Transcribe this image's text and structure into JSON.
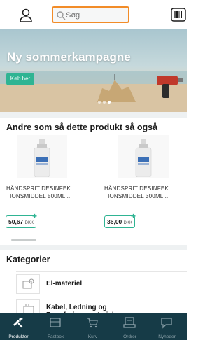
{
  "search": {
    "placeholder": "Søg"
  },
  "banner": {
    "title": "Ny sommerkampagne",
    "cta_label": "Køb her"
  },
  "recommended": {
    "title": "Andre som så dette produkt så også",
    "products": [
      {
        "name": "HÅNDSPRIT DESINFEK TIONSMIDDEL 500ML ...",
        "price": "50,67",
        "currency": "DKK"
      },
      {
        "name": "HÅNDSPRIT DESINFEK TIONSMIDDEL 300ML ...",
        "price": "36,00",
        "currency": "DKK"
      }
    ]
  },
  "categories": {
    "title": "Kategorier",
    "items": [
      {
        "label": "El-materiel"
      },
      {
        "label": "Kabel, Ledning og Fremføringsmateriel"
      }
    ]
  },
  "bottom_nav": {
    "items": [
      {
        "label": "Produkter",
        "active": true
      },
      {
        "label": "Fastbox",
        "active": false
      },
      {
        "label": "Kurv",
        "active": false
      },
      {
        "label": "Ordrer",
        "active": false
      },
      {
        "label": "Nyheder",
        "active": false
      }
    ]
  },
  "colors": {
    "accent": "#2fb493",
    "search_border": "#f28c28",
    "nav_bg": "#163b47"
  }
}
